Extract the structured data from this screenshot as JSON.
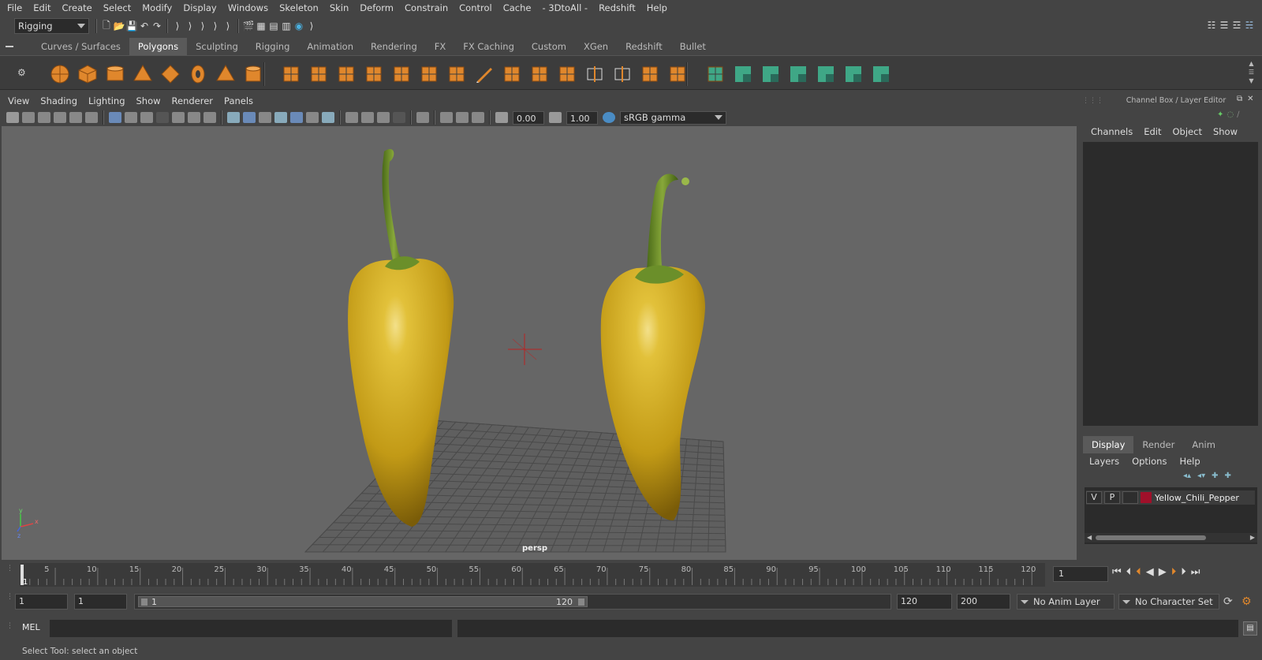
{
  "menubar": {
    "items": [
      "File",
      "Edit",
      "Create",
      "Select",
      "Modify",
      "Display",
      "Windows",
      "Skeleton",
      "Skin",
      "Deform",
      "Constrain",
      "Control",
      "Cache",
      "- 3DtoAll -",
      "Redshift",
      "Help"
    ]
  },
  "status_line": {
    "menu_set": "Rigging"
  },
  "shelf": {
    "tabs": [
      "Curves / Surfaces",
      "Polygons",
      "Sculpting",
      "Rigging",
      "Animation",
      "Rendering",
      "FX",
      "FX Caching",
      "Custom",
      "XGen",
      "Redshift",
      "Bullet"
    ],
    "active_tab": "Polygons",
    "icons": [
      "sphere-icon",
      "cube-icon",
      "cylinder-icon",
      "cone-icon",
      "plane-icon",
      "torus-icon",
      "pyramid-icon",
      "pipe-icon",
      "combine-icon",
      "separate-icon",
      "extract-icon",
      "smooth-icon",
      "bevel-icon",
      "bridge-icon",
      "extrude-icon",
      "multicut-icon",
      "target-weld-icon",
      "bevel-edge-icon",
      "planar-map-icon",
      "insert-edgeloop-icon",
      "offset-edgeloop-icon",
      "mirror-icon",
      "quad-draw-icon",
      "cut-faces-icon",
      "uv-editor-icon",
      "uv-cut-icon",
      "uv-sew-icon",
      "uv-unfold-icon",
      "uv-layout-icon",
      "uv-checker-icon",
      "uv-symmetry-icon"
    ]
  },
  "viewport": {
    "menu": [
      "View",
      "Shading",
      "Lighting",
      "Show",
      "Renderer",
      "Panels"
    ],
    "exposure": "0.00",
    "gamma": "1.00",
    "color_space": "sRGB gamma",
    "camera_label": "persp",
    "axis_labels": {
      "y": "y",
      "x": "x",
      "z": "z"
    }
  },
  "channel_box": {
    "title": "Channel Box / Layer Editor",
    "menu": [
      "Channels",
      "Edit",
      "Object",
      "Show"
    ]
  },
  "layer_editor": {
    "tabs": [
      "Display",
      "Render",
      "Anim"
    ],
    "active_tab": "Display",
    "menu": [
      "Layers",
      "Options",
      "Help"
    ],
    "layers": [
      {
        "visible": "V",
        "playback": "P",
        "color": "#a0102a",
        "name": "Yellow_Chili_Pepper"
      }
    ]
  },
  "timeline": {
    "ticks": [
      "5",
      "10",
      "15",
      "20",
      "25",
      "30",
      "35",
      "40",
      "45",
      "50",
      "55",
      "60",
      "65",
      "70",
      "75",
      "80",
      "85",
      "90",
      "95",
      "100",
      "105",
      "110",
      "115",
      "120"
    ],
    "current_marker": "1",
    "current_frame": "1"
  },
  "range": {
    "start_time": "1",
    "playback_start": "1",
    "slider_start": "1",
    "slider_end": "120",
    "playback_end": "120",
    "end_time": "200",
    "anim_layer": "No Anim Layer",
    "character_set": "No Character Set"
  },
  "command_line": {
    "label": "MEL"
  },
  "help_line": {
    "text": "Select Tool: select an object"
  },
  "colors": {
    "accent_blue": "#4a8cc4",
    "shelf_orange": "#e0872c",
    "shelf_teal": "#3fa786",
    "pepper_yellow": "#d6b22a",
    "stem_green": "#6b8f2a"
  }
}
